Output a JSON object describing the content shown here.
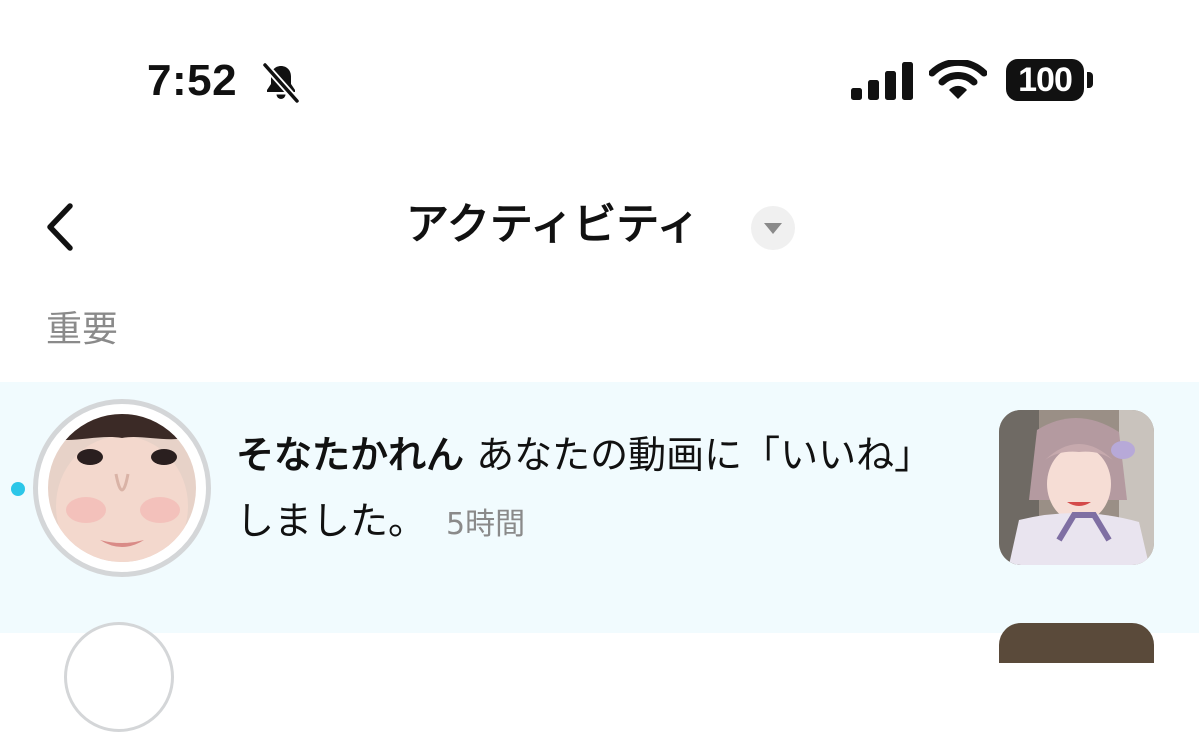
{
  "status_bar": {
    "time": "7:52",
    "mute_icon": "bell-slash-icon",
    "signal_icon": "cellular-signal-icon",
    "wifi_icon": "wifi-icon",
    "battery": "100"
  },
  "header": {
    "back_icon": "chevron-left-icon",
    "title": "アクティビティ",
    "dropdown_icon": "triangle-down-icon"
  },
  "section": {
    "label": "重要"
  },
  "notifications": [
    {
      "username": "そなたかれん",
      "message_line1": " あなたの動画に「いいね」",
      "message_line2": "しました。",
      "time_ago": "5時間",
      "unread": true
    }
  ],
  "colors": {
    "unread_dot": "#2cc6e8",
    "row_highlight": "#f1fbfe",
    "secondary_text": "#8a8a8a"
  }
}
